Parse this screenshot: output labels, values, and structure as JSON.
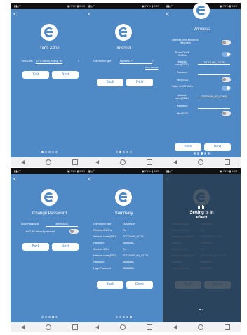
{
  "status_bar": {
    "left": "▮▮ᵤᵢ ᴴ",
    "right": "▣ 71% ▮ 5:23"
  },
  "nav": {
    "back": "◁",
    "home": "○",
    "recent": "□"
  },
  "screen1": {
    "title": "Time Zone",
    "time_zone_label": "Time Zone",
    "time_zone_value": "(UTC+08:00) Beijing, Ho",
    "exit_label": "Exit",
    "next_label": "Next"
  },
  "screen2": {
    "title": "Internet",
    "connection_label": "Connection type",
    "connection_value": "Dynamic IP",
    "more_link": "More Settings",
    "back_label": "Back",
    "next_label": "Next"
  },
  "screen3": {
    "title": "Wireless",
    "smart_label": "Wireless multi frequency integration",
    "radio24_label": "Radio On/Off 2.4GHz",
    "name24_label": "Network name(SSID)",
    "name24_value": "TOTOLINK_X7125",
    "pwd1_label": "Password",
    "hide1_label": "Hide SSID",
    "radio5_label": "Radio On/Off 5GHz",
    "name5_label": "Network name(SSID)",
    "name5_value": "TOTOLINK_5G_X7125",
    "pwd2_label": "Password",
    "hide2_label": "Hide SSID",
    "back_label": "Back",
    "next_label": "Next"
  },
  "screen4": {
    "title": "Change Password",
    "login_label": "Login Password",
    "login_value": "admin0000",
    "without_label": "Use 2.4G without password",
    "back_label": "Back",
    "next_label": "Next"
  },
  "screen5": {
    "title": "Summary",
    "rows": [
      {
        "k": "Connection type",
        "v": "Dynamic IP"
      },
      {
        "k": "Wireless 2.4GHz",
        "v": "On"
      },
      {
        "k": "Network name(SSID)",
        "v": "TOTOLINK_X7125"
      },
      {
        "k": "Password",
        "v": "88888888"
      },
      {
        "k": "Wireless 5GHz",
        "v": "On"
      },
      {
        "k": "Network name(SSID)",
        "v": "TOTOLINK_5G_X7125"
      },
      {
        "k": "Password",
        "v": "88888888"
      },
      {
        "k": "Login Password",
        "v": "88888888"
      }
    ],
    "back_label": "Back",
    "done_label": "Done"
  },
  "screen6": {
    "message_line1": "Setting is in",
    "message_line2": "effect"
  }
}
